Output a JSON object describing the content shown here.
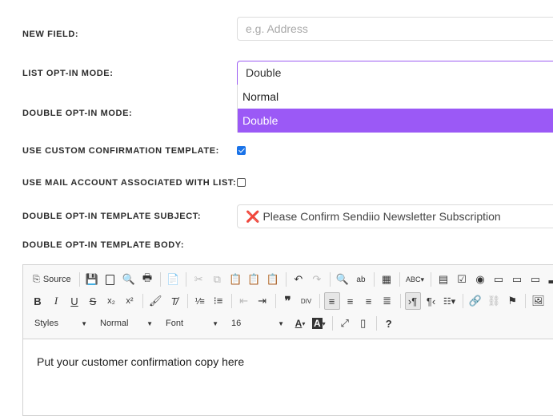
{
  "fields": {
    "new_field": {
      "label": "NEW FIELD:",
      "placeholder": "e.g. Address"
    },
    "list_optin_mode": {
      "label": "LIST OPT-IN MODE:",
      "value": "Double",
      "options": [
        "Normal",
        "Double"
      ]
    },
    "double_optin_mode": {
      "label": "DOUBLE OPT-IN MODE:"
    },
    "use_custom_template": {
      "label": "USE CUSTOM CONFIRMATION TEMPLATE:",
      "checked": true
    },
    "use_mail_account": {
      "label": "USE MAIL ACCOUNT ASSOCIATED WITH LIST:",
      "checked": false
    },
    "template_subject": {
      "label": "DOUBLE OPT-IN TEMPLATE SUBJECT:",
      "value": "Please Confirm Sendiio Newsletter Subscription"
    },
    "template_body": {
      "label": "DOUBLE OPT-IN TEMPLATE BODY:"
    }
  },
  "editor": {
    "source_label": "Source",
    "styles_label": "Styles",
    "format_label": "Normal",
    "font_label": "Font",
    "size_label": "16",
    "help_label": "?",
    "content": "Put your customer confirmation copy here"
  },
  "colors": {
    "accent": "#9b59f6",
    "checkbox": "#1a73e8",
    "error": "#e23b3b"
  }
}
